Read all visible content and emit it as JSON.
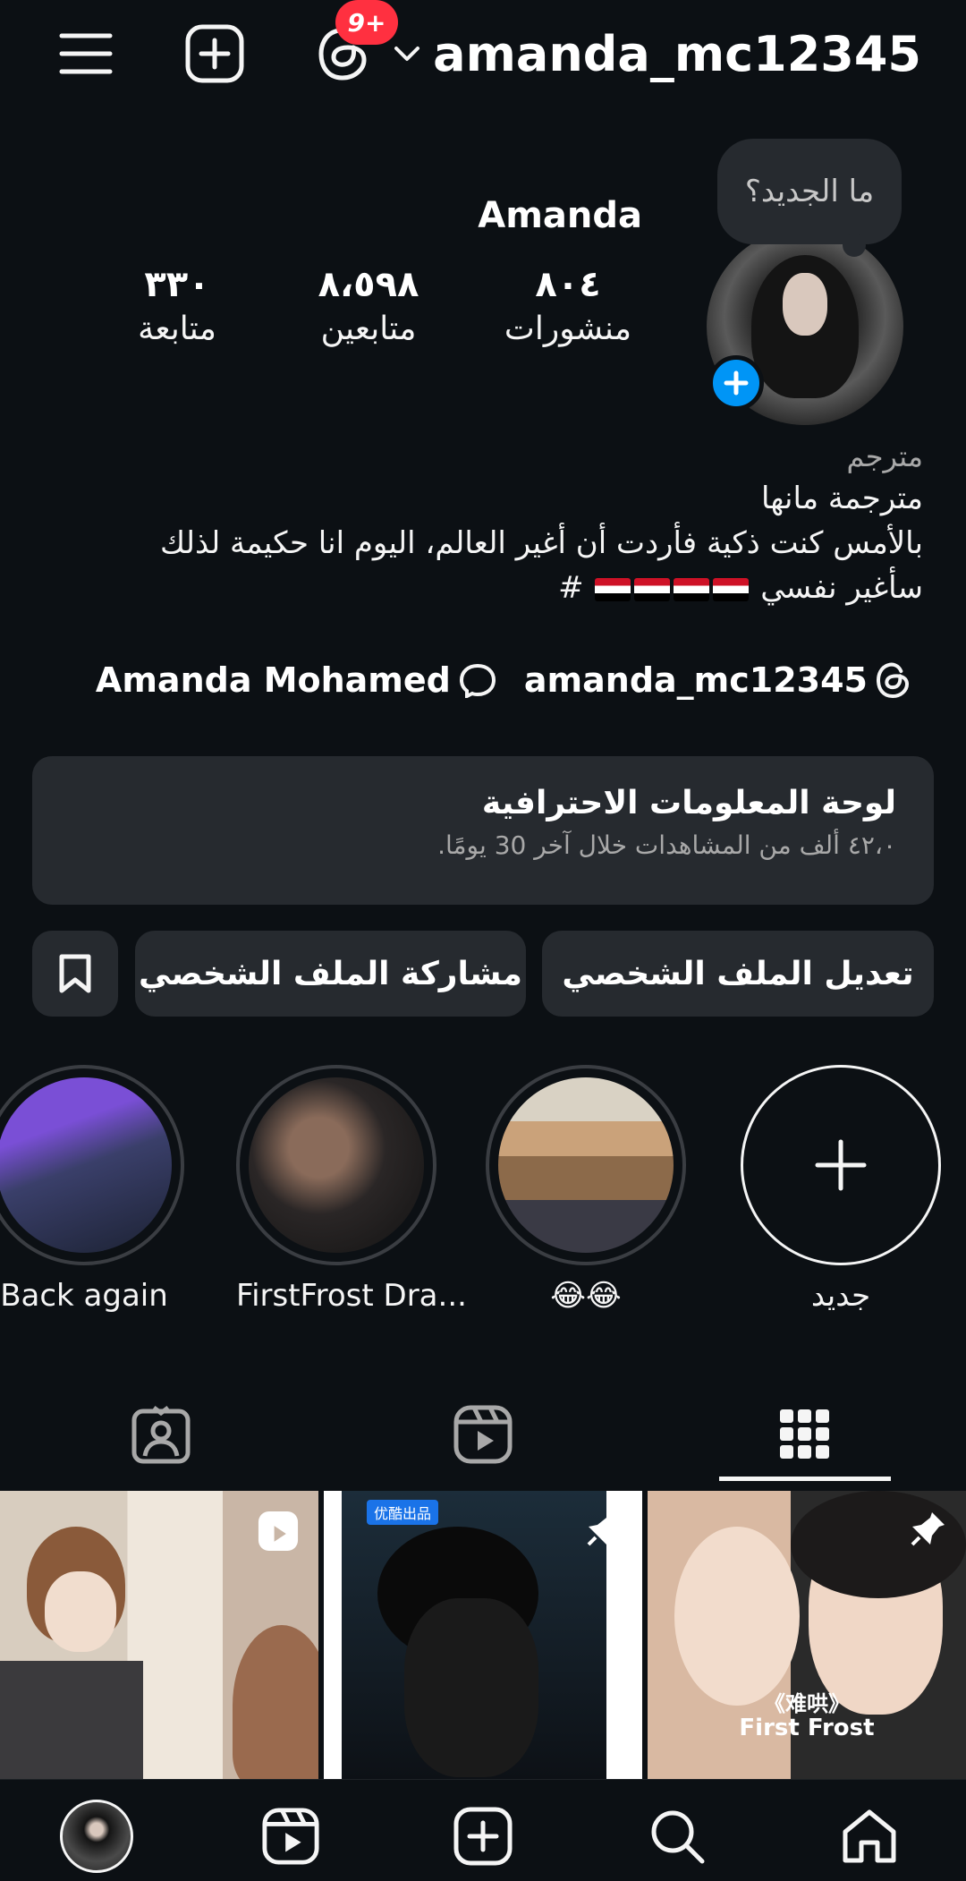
{
  "header": {
    "username": "amanda_mc12345",
    "threads_badge": "9+"
  },
  "profile": {
    "note": "ما الجديد؟",
    "display_name": "Amanda",
    "stats": [
      {
        "num": "٨٠٤",
        "label": "منشورات"
      },
      {
        "num": "٨،٥٩٨",
        "label": "متابعين"
      },
      {
        "num": "٣٣٠",
        "label": "متابعة"
      }
    ],
    "category": "مترجم",
    "bio_lines": [
      "مترجمة مانها",
      "بالأمس كنت ذكية فأردت أن أغير العالم، اليوم انا حكيمة لذلك",
      "سأغير نفسي"
    ],
    "bio_hashtag": "#",
    "threads_link": "amanda_mc12345",
    "facebook_link": "Amanda Mohamed"
  },
  "dashboard": {
    "title": "لوحة المعلومات الاحترافية",
    "subtitle": "٤٢،٠ ألف من المشاهدات خلال آخر 30 يومًا."
  },
  "buttons": {
    "edit": "تعديل الملف الشخصي",
    "share": "مشاركة الملف الشخصي"
  },
  "highlights": [
    {
      "label": "جديد"
    },
    {
      "label": "😂😂"
    },
    {
      "label": "FirstFrost Dra..."
    },
    {
      "label": "Back again"
    }
  ],
  "grid": {
    "post3_caption_cn": "《难哄》",
    "post3_caption_en": "First Frost",
    "post2_tag": "优酷出品"
  },
  "colors": {
    "background": "#0c1014",
    "card": "#262a2f",
    "accent_blue": "#0095f6",
    "badge_red": "#ff3040"
  }
}
